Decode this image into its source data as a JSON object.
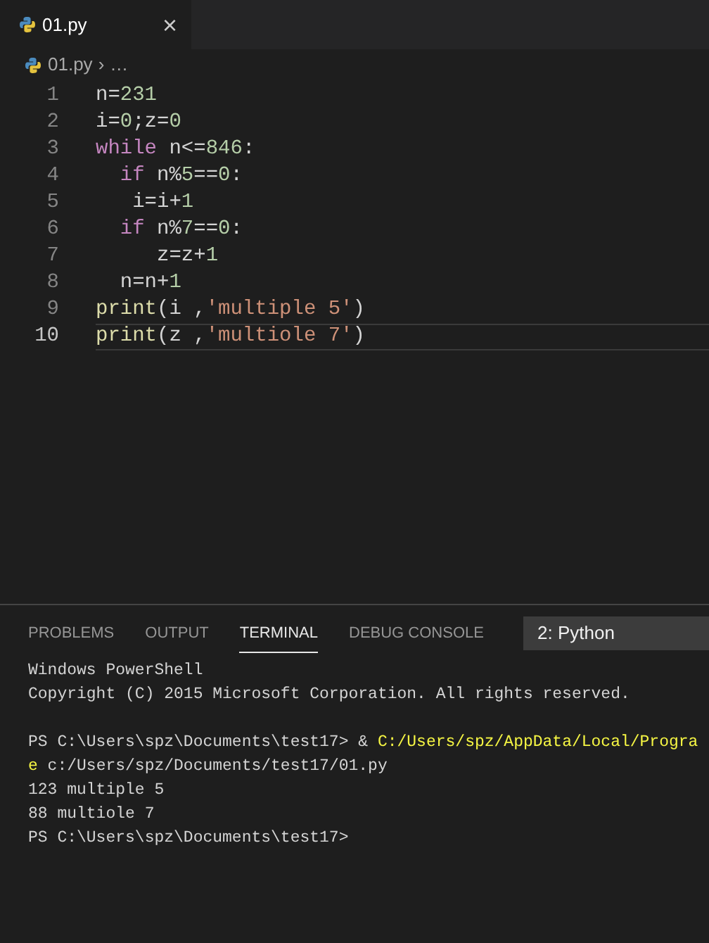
{
  "tabs": [
    {
      "label": "01.py",
      "selected": true,
      "close": "×"
    }
  ],
  "breadcrumb": {
    "file": "01.py",
    "separator": "›",
    "more": "…"
  },
  "code": {
    "lines": [
      {
        "number": "1",
        "selected": false,
        "tokens": [
          {
            "text": "n=",
            "kind": "plain"
          },
          {
            "text": "231",
            "kind": "number"
          }
        ]
      },
      {
        "number": "2",
        "selected": false,
        "tokens": [
          {
            "text": "i=",
            "kind": "plain"
          },
          {
            "text": "0",
            "kind": "number"
          },
          {
            "text": ";z=",
            "kind": "plain"
          },
          {
            "text": "0",
            "kind": "number"
          }
        ]
      },
      {
        "number": "3",
        "selected": false,
        "tokens": [
          {
            "text": "while",
            "kind": "keyword"
          },
          {
            "text": " n<=",
            "kind": "plain"
          },
          {
            "text": "846",
            "kind": "number"
          },
          {
            "text": ":",
            "kind": "plain"
          }
        ]
      },
      {
        "number": "4",
        "selected": false,
        "tokens": [
          {
            "text": "  if",
            "kind": "keyword"
          },
          {
            "text": " n%",
            "kind": "plain"
          },
          {
            "text": "5",
            "kind": "number"
          },
          {
            "text": "==",
            "kind": "plain"
          },
          {
            "text": "0",
            "kind": "number"
          },
          {
            "text": ":",
            "kind": "plain"
          }
        ]
      },
      {
        "number": "5",
        "selected": false,
        "tokens": [
          {
            "text": "   i=i+",
            "kind": "plain"
          },
          {
            "text": "1",
            "kind": "number"
          }
        ]
      },
      {
        "number": "6",
        "selected": false,
        "tokens": [
          {
            "text": "  if",
            "kind": "keyword"
          },
          {
            "text": " n%",
            "kind": "plain"
          },
          {
            "text": "7",
            "kind": "number"
          },
          {
            "text": "==",
            "kind": "plain"
          },
          {
            "text": "0",
            "kind": "number"
          },
          {
            "text": ":",
            "kind": "plain"
          }
        ]
      },
      {
        "number": "7",
        "selected": false,
        "tokens": [
          {
            "text": "     z=z+",
            "kind": "plain"
          },
          {
            "text": "1",
            "kind": "number"
          }
        ]
      },
      {
        "number": "8",
        "selected": false,
        "tokens": [
          {
            "text": "  n=n+",
            "kind": "plain"
          },
          {
            "text": "1",
            "kind": "number"
          }
        ]
      },
      {
        "number": "9",
        "selected": false,
        "tokens": [
          {
            "text": "print",
            "kind": "function"
          },
          {
            "text": "(i ,",
            "kind": "plain"
          },
          {
            "text": "'multiple 5'",
            "kind": "string"
          },
          {
            "text": ")",
            "kind": "plain"
          }
        ]
      },
      {
        "number": "10",
        "selected": true,
        "tokens": [
          {
            "text": "print",
            "kind": "function"
          },
          {
            "text": "(z ,",
            "kind": "plain"
          },
          {
            "text": "'multiole 7'",
            "kind": "string"
          },
          {
            "text": ")",
            "kind": "plain"
          }
        ]
      }
    ]
  },
  "panel_tabs": [
    {
      "label": "PROBLEMS",
      "selected": false
    },
    {
      "label": "OUTPUT",
      "selected": false
    },
    {
      "label": "TERMINAL",
      "selected": true
    },
    {
      "label": "DEBUG CONSOLE",
      "selected": false
    }
  ],
  "terminal_select": "2: Python",
  "terminal": [
    {
      "segments": [
        {
          "text": "Windows PowerShell",
          "kind": "plain"
        }
      ]
    },
    {
      "segments": [
        {
          "text": "Copyright (C) 2015 Microsoft Corporation. All rights reserved.",
          "kind": "plain"
        }
      ]
    },
    {
      "gap_before": true,
      "segments": [
        {
          "text": "PS C:\\Users\\spz\\Documents\\test17> & ",
          "kind": "plain"
        },
        {
          "text": "C:/Users/spz/AppData/Local/Progra",
          "kind": "path"
        }
      ]
    },
    {
      "segments": [
        {
          "text": "e",
          "kind": "path"
        },
        {
          "text": " c:/Users/spz/Documents/test17/01.py",
          "kind": "plain"
        }
      ]
    },
    {
      "segments": [
        {
          "text": "123 multiple 5",
          "kind": "plain"
        }
      ]
    },
    {
      "segments": [
        {
          "text": "88 multiole 7",
          "kind": "plain"
        }
      ]
    },
    {
      "segments": [
        {
          "text": "PS C:\\Users\\spz\\Documents\\test17>",
          "kind": "plain"
        }
      ]
    }
  ]
}
